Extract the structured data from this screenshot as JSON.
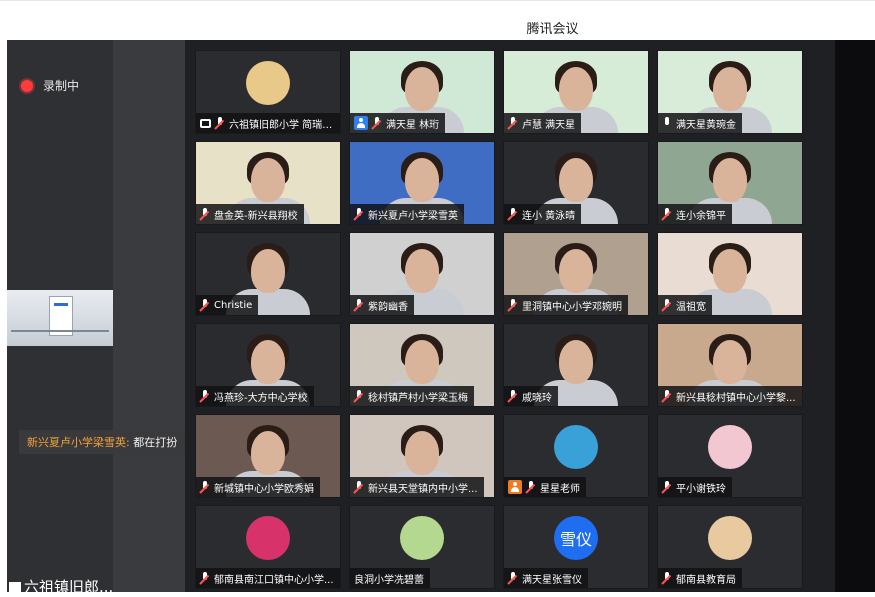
{
  "window": {
    "title": "腾讯会议"
  },
  "recording": {
    "label": "录制中"
  },
  "chat": {
    "sender": "新兴夏卢小学梁雪英:",
    "message": "都在打扮"
  },
  "bottom_user": {
    "name": "六祖镇旧郎..."
  },
  "participants": [
    {
      "name": "六祖镇旧郎小学 简瑞文的...",
      "mic": "muted",
      "icon": "screen-share-icon",
      "video": "avatar",
      "bg": "#e9c98a"
    },
    {
      "name": "满天星 林珩",
      "mic": "muted",
      "icon": "user-icon",
      "video": "video",
      "bg": "#cfe9d6"
    },
    {
      "name": "卢慧 满天星",
      "mic": "muted",
      "icon": "",
      "video": "video",
      "bg": "#d7ecd7"
    },
    {
      "name": "满天星黄琬金",
      "mic": "on",
      "icon": "",
      "video": "video",
      "bg": "#d9ecd9"
    },
    {
      "name": "盘金英-新兴县翔校",
      "mic": "muted",
      "icon": "",
      "video": "video",
      "bg": "#e6e1c7"
    },
    {
      "name": "新兴夏卢小学梁雪英",
      "mic": "muted",
      "icon": "",
      "video": "video",
      "bg": "#3f6dc3"
    },
    {
      "name": "连小 黄泳晴",
      "mic": "muted",
      "icon": "",
      "video": "video",
      "bg": "#2a2b2f"
    },
    {
      "name": "连小余锦平",
      "mic": "muted",
      "icon": "",
      "video": "video",
      "bg": "#8fa692"
    },
    {
      "name": "Christie",
      "mic": "muted",
      "icon": "",
      "video": "video",
      "bg": "#2a2b2f"
    },
    {
      "name": "紫韵幽香",
      "mic": "muted",
      "icon": "",
      "video": "video",
      "bg": "#cfd0cf"
    },
    {
      "name": "里洞镇中心小学邓婉明",
      "mic": "muted",
      "icon": "",
      "video": "video",
      "bg": "#b0a08f"
    },
    {
      "name": "温祖宽",
      "mic": "muted",
      "icon": "",
      "video": "video",
      "bg": "#e9dcd2"
    },
    {
      "name": "冯燕珍-大方中心学校",
      "mic": "muted",
      "icon": "",
      "video": "video",
      "bg": "#2a2b2f"
    },
    {
      "name": "稔村镇芦村小学梁玉梅",
      "mic": "muted",
      "icon": "",
      "video": "video",
      "bg": "#cfc8be"
    },
    {
      "name": "戚晓玲",
      "mic": "muted",
      "icon": "",
      "video": "video",
      "bg": "#2a2b2f"
    },
    {
      "name": "新兴县稔村镇中心小学黎...",
      "mic": "muted",
      "icon": "",
      "video": "video",
      "bg": "#c9a98e"
    },
    {
      "name": "新城镇中心小学欧秀娟",
      "mic": "muted",
      "icon": "",
      "video": "video",
      "bg": "#6c5a52"
    },
    {
      "name": "新兴县天堂镇内中小学...",
      "mic": "muted",
      "icon": "",
      "video": "video",
      "bg": "#d0c6bd"
    },
    {
      "name": "星星老师",
      "mic": "muted",
      "icon": "user-icon-orange",
      "video": "avatar",
      "bg": "#3aa0d8"
    },
    {
      "name": "平小谢铁玲",
      "mic": "muted",
      "icon": "",
      "video": "avatar",
      "bg": "#f3c7d2"
    },
    {
      "name": "郁南县南江口镇中心小学...",
      "mic": "muted",
      "icon": "",
      "video": "avatar",
      "bg": "#d8326a"
    },
    {
      "name": "良洞小学冼碧蕾",
      "mic": "",
      "icon": "",
      "video": "avatar",
      "bg": "#b4d88f"
    },
    {
      "name": "满天星张雪仪",
      "mic": "muted",
      "icon": "",
      "video": "avatar-text",
      "avatar_text": "雪仪",
      "bg": "#1f6df0"
    },
    {
      "name": "郁南县教育局",
      "mic": "muted",
      "icon": "",
      "video": "avatar",
      "bg": "#e8c9a0"
    }
  ]
}
